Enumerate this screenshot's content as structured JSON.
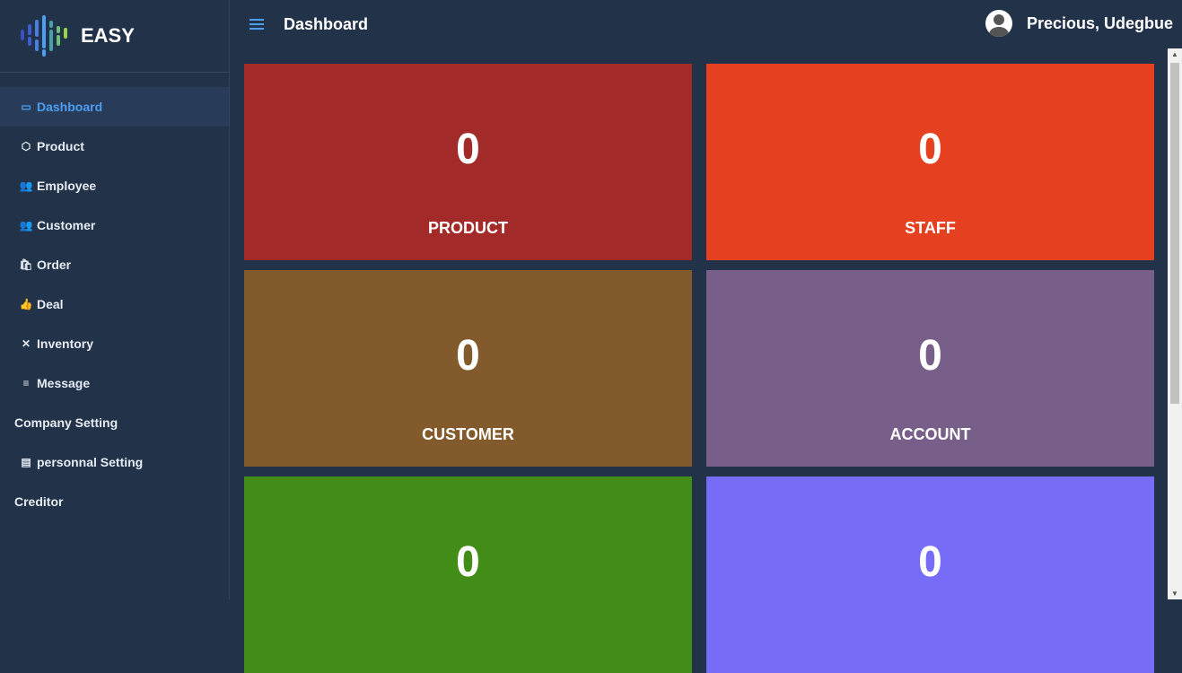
{
  "brand": {
    "name": "EASY"
  },
  "header": {
    "title": "Dashboard",
    "user": "Precious, Udegbue"
  },
  "sidebar": {
    "items": [
      {
        "label": "Dashboard",
        "icon": "window-icon",
        "glyph": "▭",
        "active": true
      },
      {
        "label": "Product",
        "icon": "box-icon",
        "glyph": "⬡"
      },
      {
        "label": "Employee",
        "icon": "people-icon",
        "glyph": "👥"
      },
      {
        "label": "Customer",
        "icon": "users-icon",
        "glyph": "👥"
      },
      {
        "label": "Order",
        "icon": "bag-icon",
        "glyph": "🛍"
      },
      {
        "label": "Deal",
        "icon": "thumbs-up-icon",
        "glyph": "👍"
      },
      {
        "label": "Inventory",
        "icon": "tools-icon",
        "glyph": "✕"
      },
      {
        "label": "Message",
        "icon": "chat-icon",
        "glyph": "≡"
      },
      {
        "label": "Company Setting"
      },
      {
        "label": "personnal Setting",
        "icon": "list-icon",
        "glyph": "▤"
      },
      {
        "label": "Creditor"
      }
    ]
  },
  "cards": [
    {
      "value": "0",
      "label": "PRODUCT",
      "color": "#a22b2a"
    },
    {
      "value": "0",
      "label": "STAFF",
      "color": "#e54020"
    },
    {
      "value": "0",
      "label": "CUSTOMER",
      "color": "#825a2c"
    },
    {
      "value": "0",
      "label": "ACCOUNT",
      "color": "#775f8a"
    },
    {
      "value": "0",
      "label": "",
      "color": "#428c18"
    },
    {
      "value": "0",
      "label": "",
      "color": "#776cf8"
    }
  ]
}
